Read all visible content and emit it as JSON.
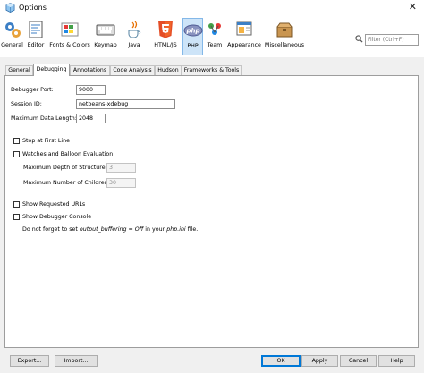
{
  "window": {
    "title": "Options"
  },
  "toolbar": {
    "items": [
      {
        "label": "General"
      },
      {
        "label": "Editor"
      },
      {
        "label": "Fonts & Colors"
      },
      {
        "label": "Keymap"
      },
      {
        "label": "Java"
      },
      {
        "label": "HTML/JS"
      },
      {
        "label": "PHP"
      },
      {
        "label": "Team"
      },
      {
        "label": "Appearance"
      },
      {
        "label": "Miscellaneous"
      }
    ],
    "selected": "PHP",
    "filter_placeholder": "Filter (Ctrl+F)"
  },
  "tabs": [
    {
      "label": "General"
    },
    {
      "label": "Debugging"
    },
    {
      "label": "Annotations"
    },
    {
      "label": "Code Analysis"
    },
    {
      "label": "Hudson"
    },
    {
      "label": "Frameworks & Tools"
    }
  ],
  "active_tab": "Debugging",
  "form": {
    "debugger_port_label": "Debugger Port:",
    "debugger_port_value": "9000",
    "session_id_label": "Session ID:",
    "session_id_value": "netbeans-xdebug",
    "max_data_length_label": "Maximum Data Length:",
    "max_data_length_value": "2048",
    "stop_first_line": "Stop at First Line",
    "watches_balloon": "Watches and Balloon Evaluation",
    "max_depth_label": "Maximum Depth of Structures:",
    "max_depth_value": "3",
    "max_children_label": "Maximum Number of Children:",
    "max_children_value": "30",
    "show_urls": "Show Requested URLs",
    "show_console": "Show Debugger Console",
    "note_prefix": "Do not forget to set ",
    "note_em1": "output_buffering = Off",
    "note_mid": " in your ",
    "note_em2": "php.ini",
    "note_suffix": " file."
  },
  "buttons": {
    "export": "Export...",
    "import": "Import...",
    "ok": "OK",
    "apply": "Apply",
    "cancel": "Cancel",
    "help": "Help"
  }
}
